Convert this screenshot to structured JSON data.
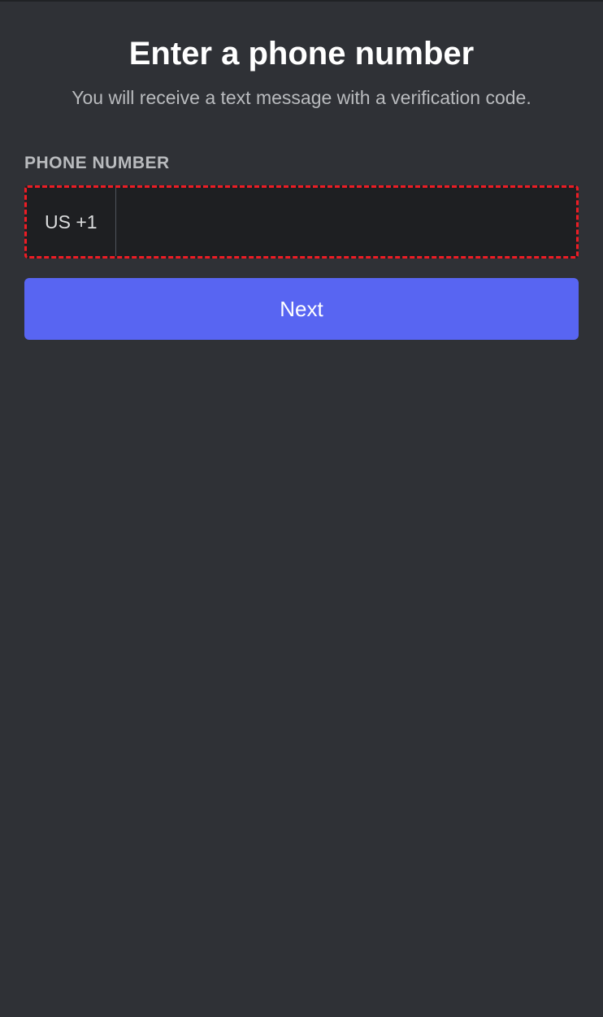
{
  "header": {
    "title": "Enter a phone number",
    "subtitle": "You will receive a text message with a verification code."
  },
  "form": {
    "phone_label": "PHONE NUMBER",
    "country_code": "US +1",
    "phone_value": "",
    "next_button_label": "Next"
  }
}
